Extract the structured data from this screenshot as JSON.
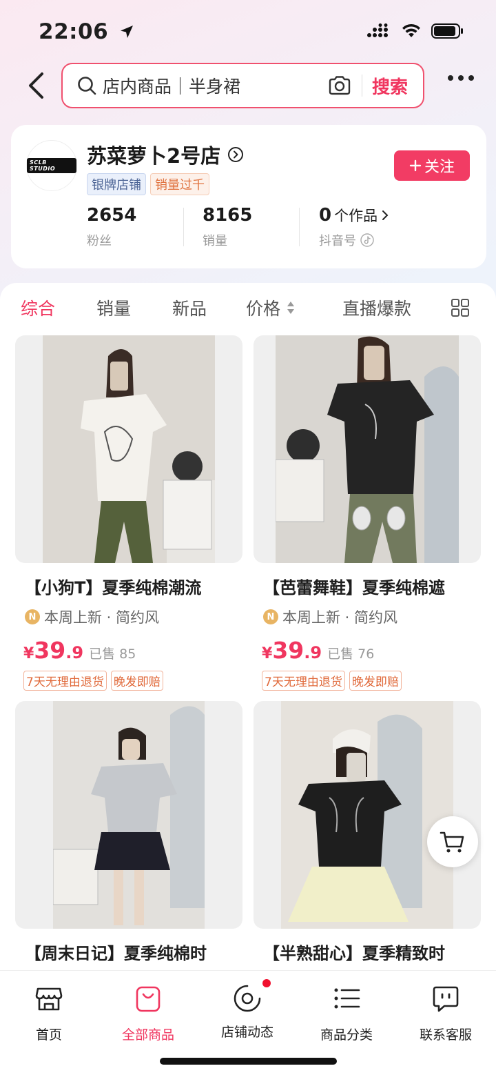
{
  "status_bar": {
    "time": "22:06"
  },
  "search": {
    "placeholder": "店内商品｜半身裙",
    "button": "搜索"
  },
  "shop": {
    "logo_text": "SCLB STUDIO",
    "name": "苏菜萝卜2号店",
    "badges": [
      "银牌店铺",
      "销量过千"
    ],
    "follow_label": "关注",
    "stats": {
      "fans_value": "2654",
      "fans_label": "粉丝",
      "sales_value": "8165",
      "sales_label": "销量",
      "works_value": "0",
      "works_unit": "个作品",
      "works_label": "抖音号"
    }
  },
  "tabs": [
    "综合",
    "销量",
    "新品",
    "价格",
    "直播爆款"
  ],
  "products": [
    {
      "title": "【小狗T】夏季纯棉潮流",
      "tags": "本周上新 · 简约风",
      "price_symbol": "¥",
      "price_int": "39",
      "price_dec": ".9",
      "sold": "已售 85",
      "services": [
        "7天无理由退货",
        "晚发即赔"
      ]
    },
    {
      "title": "【芭蕾舞鞋】夏季纯棉遮",
      "tags": "本周上新 · 简约风",
      "price_symbol": "¥",
      "price_int": "39",
      "price_dec": ".9",
      "sold": "已售 76",
      "services": [
        "7天无理由退货",
        "晚发即赔"
      ]
    },
    {
      "title": "【周末日记】夏季纯棉时"
    },
    {
      "title": "【半熟甜心】夏季精致时"
    }
  ],
  "bottom_nav": [
    {
      "label": "首页",
      "icon": "store-icon"
    },
    {
      "label": "全部商品",
      "icon": "bag-icon"
    },
    {
      "label": "店铺动态",
      "icon": "live-icon"
    },
    {
      "label": "商品分类",
      "icon": "list-icon"
    },
    {
      "label": "联系客服",
      "icon": "chat-icon"
    }
  ],
  "colors": {
    "accent": "#f0365f",
    "follow": "#f23c64"
  }
}
